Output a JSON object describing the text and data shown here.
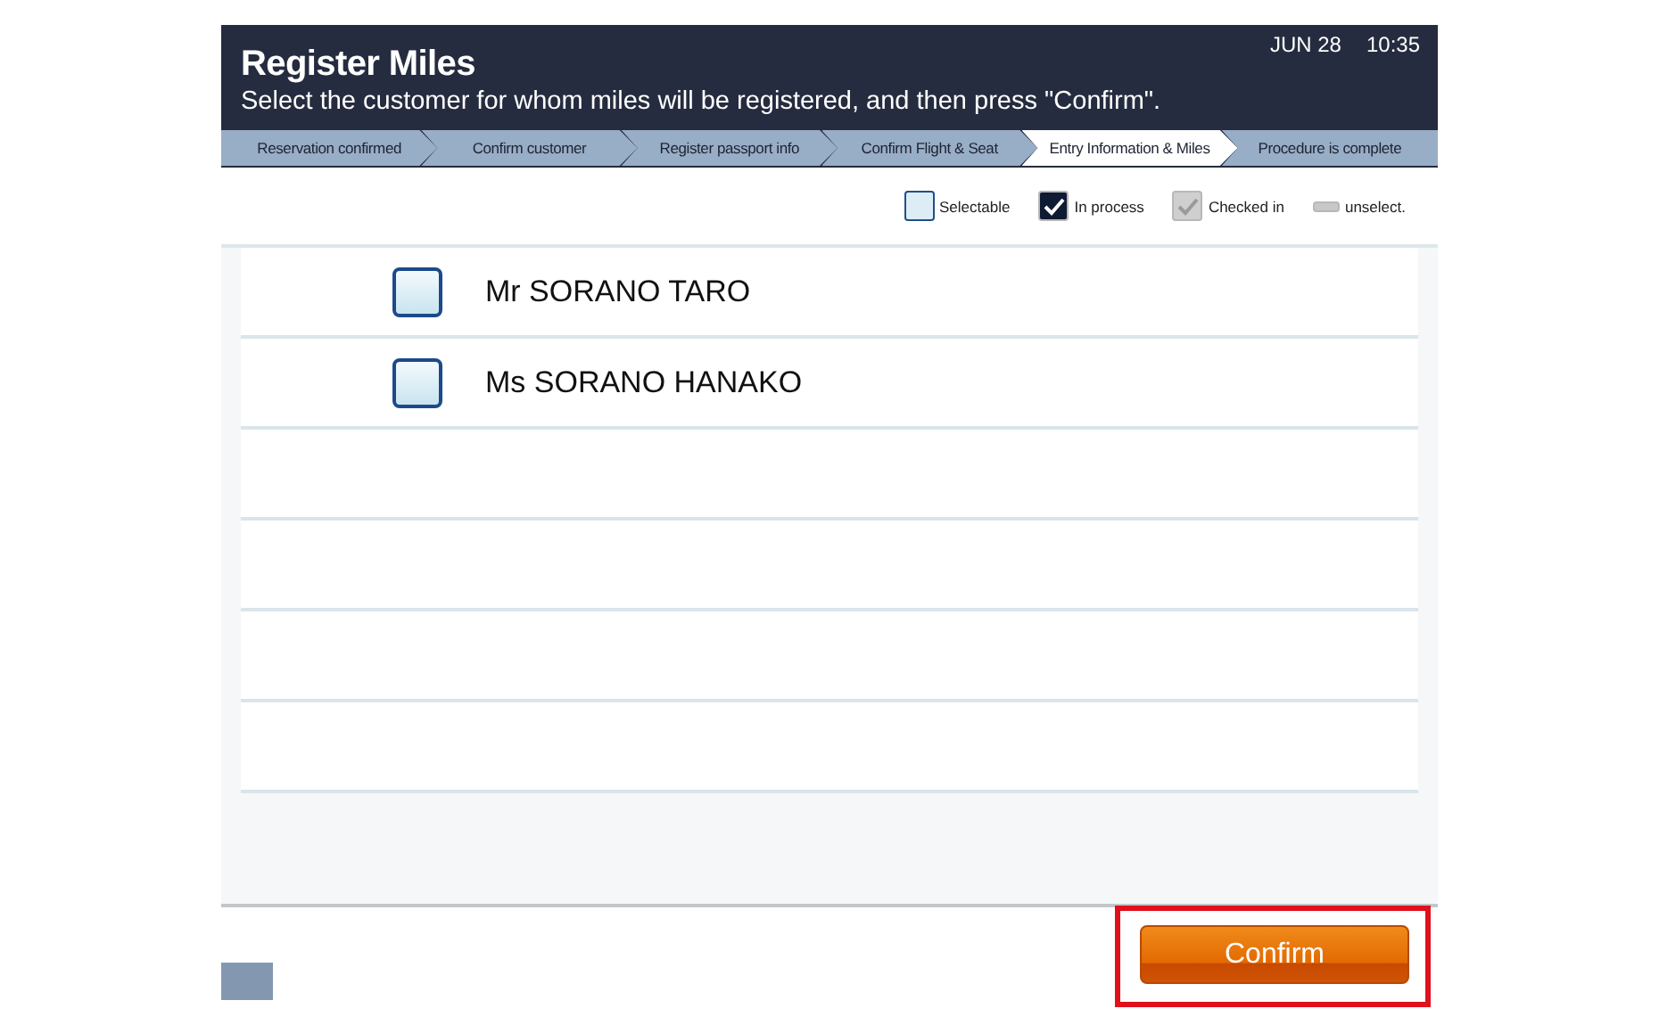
{
  "header": {
    "title": "Register Miles",
    "instruction": "Select the customer for whom miles will be registered, and then press \"Confirm\".",
    "date": "JUN 28",
    "time": "10:35"
  },
  "steps": [
    {
      "label": "Reservation confirmed",
      "selected": false
    },
    {
      "label": "Confirm customer",
      "selected": false
    },
    {
      "label": "Register passport info",
      "selected": false
    },
    {
      "label": "Confirm Flight & Seat",
      "selected": false
    },
    {
      "label": "Entry Information  & Miles",
      "selected": true
    },
    {
      "label": "Procedure is complete",
      "selected": false
    }
  ],
  "legend": [
    {
      "kind": "selectable",
      "label": "Selectable"
    },
    {
      "kind": "in_process",
      "label": "In process"
    },
    {
      "kind": "checked_in",
      "label": "Checked in"
    },
    {
      "kind": "unselect",
      "label": "unselect."
    }
  ],
  "customers": [
    {
      "name": "Mr SORANO TARO",
      "checked": false
    },
    {
      "name": "Ms SORANO HANAKO",
      "checked": false
    }
  ],
  "confirm_button": {
    "label": "Confirm",
    "highlighted": true
  }
}
